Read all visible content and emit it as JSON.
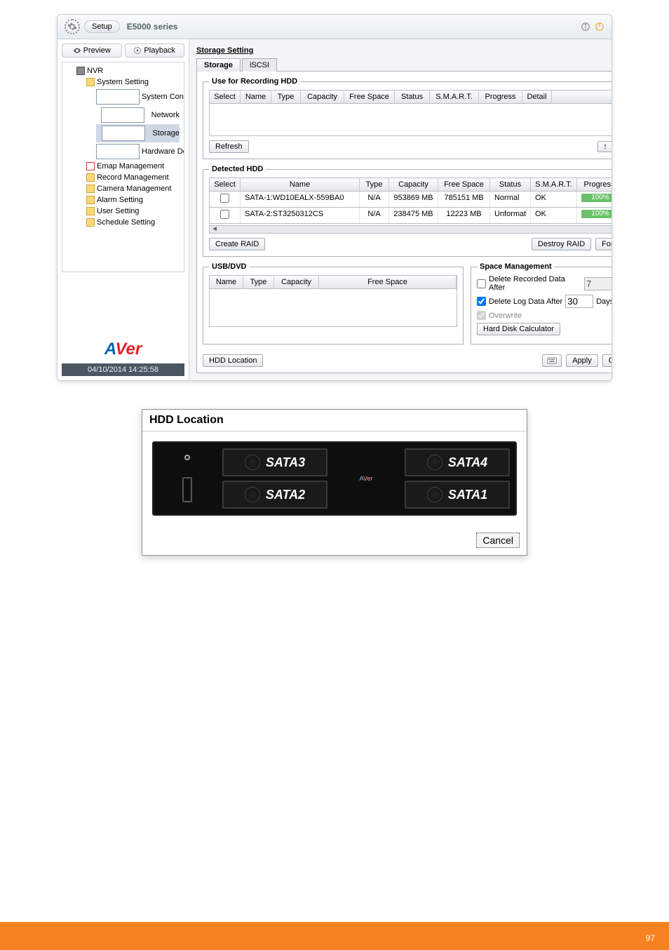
{
  "titlebar": {
    "setup_label": "Setup",
    "series": "E5000 series"
  },
  "sidebar": {
    "tabs": {
      "preview": "Preview",
      "playback": "Playback"
    },
    "tree": {
      "root": "NVR",
      "system_setting": "System Setting",
      "system_config": "System Configurati...",
      "network": "Network",
      "storage": "Storage",
      "hardware": "Hardware Device",
      "emap": "Emap Management",
      "record": "Record Management",
      "camera": "Camera Management",
      "alarm": "Alarm Setting",
      "user": "User Setting",
      "schedule": "Schedule Setting"
    },
    "datetime": "04/10/2014 14:25:58"
  },
  "main": {
    "section_title": "Storage Setting",
    "tabs": {
      "storage": "Storage",
      "iscsi": "iSCSI"
    },
    "rec_hdd": {
      "legend": "Use for Recording HDD",
      "headers": [
        "Select",
        "Name",
        "Type",
        "Capacity",
        "Free Space",
        "Status",
        "S.M.A.R.T.",
        "Progress",
        "Detail"
      ],
      "refresh": "Refresh"
    },
    "detected": {
      "legend": "Detected HDD",
      "headers": [
        "Select",
        "Name",
        "Type",
        "Capacity",
        "Free Space",
        "Status",
        "S.M.A.R.T.",
        "Progress"
      ],
      "rows": [
        {
          "name": "SATA-1:WD10EALX-559BA0",
          "type": "N/A",
          "capacity": "953869 MB",
          "free": "785151 MB",
          "status": "Normal",
          "smart": "OK",
          "progress": "100%"
        },
        {
          "name": "SATA-2:ST3250312CS",
          "type": "N/A",
          "capacity": "238475 MB",
          "free": "12223 MB",
          "status": "Unformat",
          "smart": "OK",
          "progress": "100%"
        }
      ],
      "create_raid": "Create RAID",
      "destroy_raid": "Destroy RAID",
      "format": "Format"
    },
    "usb": {
      "legend": "USB/DVD",
      "headers": [
        "Name",
        "Type",
        "Capacity",
        "Free Space"
      ]
    },
    "space": {
      "legend": "Space Management",
      "delete_rec": "Delete Recorded Data After",
      "delete_rec_val": "7",
      "delete_log": "Delete Log Data After",
      "delete_log_val": "30",
      "days": "Days",
      "overwrite": "Overwrite",
      "hdd_calc": "Hard Disk Calculator"
    },
    "footer": {
      "hdd_location": "HDD Location",
      "apply": "Apply",
      "cancel": "Cancel"
    }
  },
  "hdd_modal": {
    "title": "HDD Location",
    "bays": {
      "tl": "SATA3",
      "tr": "SATA4",
      "bl": "SATA2",
      "br": "SATA1"
    },
    "cancel": "Cancel"
  },
  "page_number": "97"
}
